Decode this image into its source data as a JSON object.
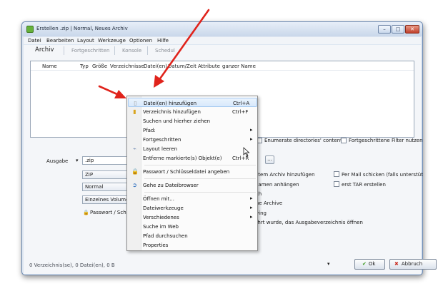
{
  "window": {
    "title": "Erstellen .zip | Normal, Neues Archiv",
    "minimize": "–",
    "maximize": "□",
    "close": "✕"
  },
  "menubar": [
    "Datei",
    "Bearbeiten",
    "Layout",
    "Werkzeuge",
    "Optionen",
    "Hilfe"
  ],
  "tabs": [
    "Archiv",
    "Fortgeschritten",
    "Konsole",
    "Schedul"
  ],
  "list_columns": [
    "Name",
    "Typ",
    "Größe",
    "Verzeichnisse",
    "Datei(en)",
    "Datum/Zeit",
    "Attribute",
    "ganzer Name"
  ],
  "filter_options": {
    "enumerate": "Enumerate directories' content",
    "advanced_filter": "Fortgeschrittene Filter nutzen"
  },
  "output": {
    "label": "Ausgabe",
    "value": ".zip",
    "browse": "...",
    "format": "ZIP",
    "compression": "Normal",
    "volume": "Einzelnes Volume",
    "password": "Passwort / Schlü"
  },
  "right_options": {
    "add_existing": "atem Archiv hinzufügen",
    "send_mail": "Per Mail schicken (falls unterstüt",
    "append_name": "namen anhängen",
    "tar_first": "erst TAR erstellen",
    "th": "th",
    "new_archive": "ne Archive",
    "ving": "ving",
    "open_output": "ührt wurde, das Ausgabeverzeichnis öffnen"
  },
  "status": "0 Verzeichnis(se), 0 Datei(en), 0 B",
  "ok_button": "Ok",
  "abort_button": "Abbruch",
  "context_menu": [
    {
      "label": "Datei(en) hinzufügen",
      "shortcut": "Ctrl+A",
      "icon": "file-icon",
      "highlighted": true
    },
    {
      "label": "Verzeichnis hinzufügen",
      "shortcut": "Ctrl+F",
      "icon": "folder-icon"
    },
    {
      "label": "Suchen und hierher ziehen",
      "shortcut": ""
    },
    {
      "label": "Pfad:",
      "shortcut": "",
      "submenu": true
    },
    {
      "label": "Fortgeschritten",
      "shortcut": "",
      "submenu": true
    },
    {
      "label": "Layout leeren",
      "shortcut": "",
      "icon": "broom-icon"
    },
    {
      "label": "Entferne markierte(s) Objekt(e)",
      "shortcut": "Ctrl+R"
    },
    {
      "label": "Passwort / Schlüsseldatei angeben",
      "shortcut": "",
      "icon": "lock-icon"
    },
    {
      "label": "Gehe zu Dateibrowser",
      "shortcut": "",
      "icon": "arrow-circle-icon"
    },
    {
      "label": "Öffnen mit...",
      "shortcut": "",
      "submenu": true
    },
    {
      "label": "Dateiwerkzeuge",
      "shortcut": "",
      "submenu": true
    },
    {
      "label": "Verschiedenes",
      "shortcut": "",
      "submenu": true
    },
    {
      "label": "Suche im Web",
      "shortcut": ""
    },
    {
      "label": "Pfad durchsuchen",
      "shortcut": ""
    },
    {
      "label": "Properties",
      "shortcut": ""
    }
  ],
  "colors": {
    "arrow": "#e0231b",
    "menu_highlight": "#d8e9fc",
    "ok_check": "#3b9a1e",
    "abort_x": "#c92a1e"
  }
}
